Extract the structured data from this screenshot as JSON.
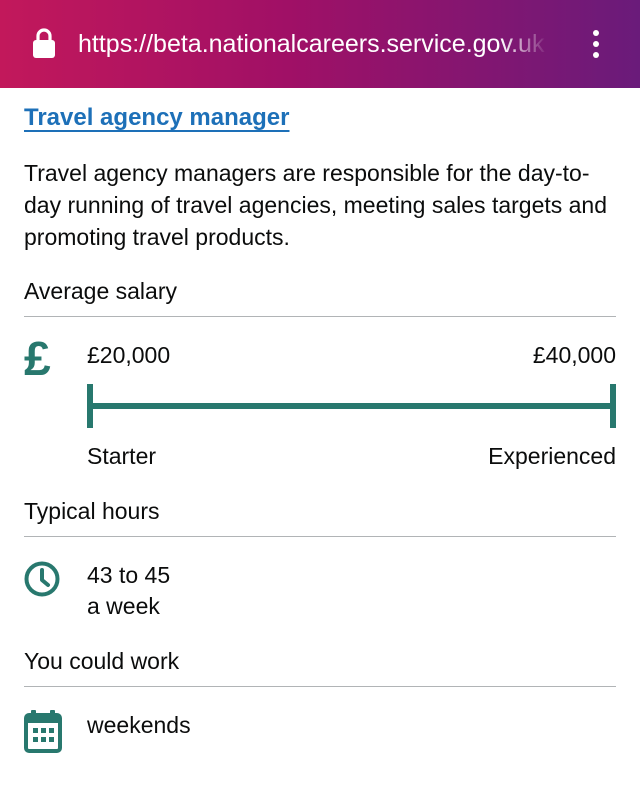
{
  "browser": {
    "url": "https://beta.nationalcareers.service.gov.uk"
  },
  "career": {
    "title": "Travel agency manager",
    "description": "Travel agency managers are responsible for the day-to-day running of travel agencies, meeting sales targets and promoting travel products."
  },
  "salary": {
    "heading": "Average salary",
    "icon": "pound-icon",
    "starter_value": "£20,000",
    "experienced_value": "£40,000",
    "starter_label": "Starter",
    "experienced_label": "Experienced"
  },
  "hours": {
    "heading": "Typical hours",
    "icon": "clock-icon",
    "line1": "43 to 45",
    "line2": "a week"
  },
  "work": {
    "heading": "You could work",
    "icon": "calendar-icon",
    "value": "weekends"
  },
  "colors": {
    "accent": "#28786e",
    "link": "#1d70b8",
    "browser_bar_start": "#c2185b",
    "browser_bar_end": "#6a1b7a"
  }
}
